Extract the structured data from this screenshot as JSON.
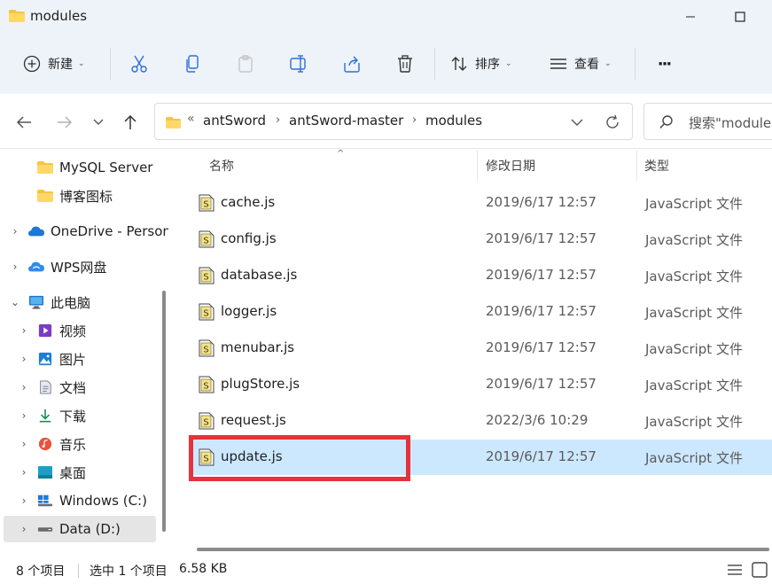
{
  "window": {
    "title": "modules"
  },
  "toolbar": {
    "new_label": "新建",
    "sort_label": "排序",
    "view_label": "查看",
    "more_label": "···"
  },
  "address": {
    "overflow": "«",
    "crumbs": [
      "antSword",
      "antSword-master",
      "modules"
    ],
    "separator": "›"
  },
  "search": {
    "placeholder": "搜索\"modules\""
  },
  "sidebar": {
    "items": [
      {
        "label": "MySQL Server",
        "icon": "folder-icon"
      },
      {
        "label": "博客图标",
        "icon": "folder-icon"
      },
      {
        "label": "OneDrive - Personal",
        "icon": "onedrive-icon"
      },
      {
        "label": "WPS网盘",
        "icon": "wps-cloud-icon"
      },
      {
        "label": "此电脑",
        "icon": "computer-icon"
      },
      {
        "label": "视频",
        "icon": "videos-icon"
      },
      {
        "label": "图片",
        "icon": "pictures-icon"
      },
      {
        "label": "文档",
        "icon": "documents-icon"
      },
      {
        "label": "下载",
        "icon": "downloads-icon"
      },
      {
        "label": "音乐",
        "icon": "music-icon"
      },
      {
        "label": "桌面",
        "icon": "desktop-icon"
      },
      {
        "label": "Windows (C:)",
        "icon": "drive-c-icon"
      },
      {
        "label": "Data (D:)",
        "icon": "drive-d-icon"
      }
    ]
  },
  "columns": {
    "name": "名称",
    "modified": "修改日期",
    "type": "类型"
  },
  "files": [
    {
      "name": "cache.js",
      "modified": "2019/6/17 12:57",
      "type": "JavaScript 文件"
    },
    {
      "name": "config.js",
      "modified": "2019/6/17 12:57",
      "type": "JavaScript 文件"
    },
    {
      "name": "database.js",
      "modified": "2019/6/17 12:57",
      "type": "JavaScript 文件"
    },
    {
      "name": "logger.js",
      "modified": "2019/6/17 12:57",
      "type": "JavaScript 文件"
    },
    {
      "name": "menubar.js",
      "modified": "2019/6/17 12:57",
      "type": "JavaScript 文件"
    },
    {
      "name": "plugStore.js",
      "modified": "2019/6/17 12:57",
      "type": "JavaScript 文件"
    },
    {
      "name": "request.js",
      "modified": "2022/3/6 10:29",
      "type": "JavaScript 文件"
    },
    {
      "name": "update.js",
      "modified": "2019/6/17 12:57",
      "type": "JavaScript 文件"
    }
  ],
  "status": {
    "count": "8 个项目",
    "selection": "选中 1 个项目",
    "size": "6.58 KB"
  },
  "colors": {
    "selected_row": "#cce8ff",
    "highlight_box": "#e8313b",
    "chrome_bg": "#eef3f9"
  }
}
